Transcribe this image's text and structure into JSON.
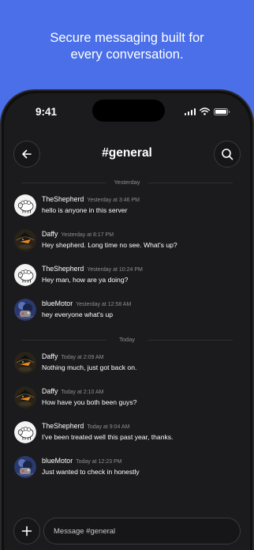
{
  "hero": {
    "line1": "Secure messaging built for",
    "line2": "every conversation."
  },
  "status_bar": {
    "time": "9:41"
  },
  "header": {
    "channel": "#general"
  },
  "dividers": {
    "yesterday": "Yesterday",
    "today": "Today"
  },
  "messages": [
    {
      "author": "TheShepherd",
      "time": "Yesterday at 3:46 PM",
      "text": "hello is anyone in this server",
      "avatar": "sheep-avatar"
    },
    {
      "author": "Daffy",
      "time": "Yesterday at 8:17 PM",
      "text": "Hey shepherd. Long time no see. What's up?",
      "avatar": "duck-avatar"
    },
    {
      "author": "TheShepherd",
      "time": "Yesterday at 10:24 PM",
      "text": "Hey man, how are ya doing?",
      "avatar": "sheep-avatar"
    },
    {
      "author": "blueMotor",
      "time": "Yesterday at 12:58 AM",
      "text": "hey everyone what's up",
      "avatar": "motor-avatar"
    },
    {
      "author": "Daffy",
      "time": "Today at 2:09 AM",
      "text": "Nothing much, just got back on.",
      "avatar": "duck-avatar"
    },
    {
      "author": "Daffy",
      "time": "Today at 2:10 AM",
      "text": "How have you both been guys?",
      "avatar": "duck-avatar"
    },
    {
      "author": "TheShepherd",
      "time": "Today at 9:04 AM",
      "text": "I've been treated well this past year, thanks.",
      "avatar": "sheep-avatar"
    },
    {
      "author": "blueMotor",
      "time": "Today at 12:23 PM",
      "text": "Just wanted to check in honestly",
      "avatar": "motor-avatar"
    }
  ],
  "composer": {
    "placeholder": "Message #general"
  },
  "icons": [
    "back-arrow-icon",
    "search-icon",
    "plus-icon",
    "signal-icon",
    "wifi-icon",
    "battery-icon"
  ],
  "colors": {
    "brand": "#4a6fe8",
    "background": "#1b1b1d",
    "text": "#ffffff",
    "muted": "#8e8e93"
  }
}
